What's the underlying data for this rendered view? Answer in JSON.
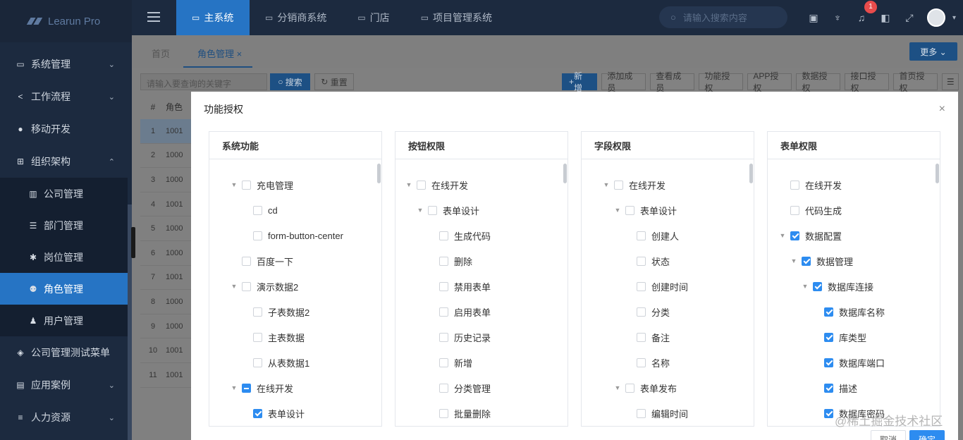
{
  "app": {
    "logo_text": "Learun Pro"
  },
  "sidebar": {
    "items": [
      {
        "label": "系统管理",
        "icon": "monitor-icon",
        "glyph": "▭",
        "chevron": "⌄"
      },
      {
        "label": "工作流程",
        "icon": "share-icon",
        "glyph": "<",
        "chevron": "⌄"
      },
      {
        "label": "移动开发",
        "icon": "github-icon",
        "glyph": "●",
        "chevron": ""
      },
      {
        "label": "组织架构",
        "icon": "sitemap-icon",
        "glyph": "⊞",
        "chevron": "⌃"
      },
      {
        "label": "公司管理",
        "icon": "bank-icon",
        "glyph": "▥",
        "sub": true
      },
      {
        "label": "部门管理",
        "icon": "list-icon",
        "glyph": "☰",
        "sub": true
      },
      {
        "label": "岗位管理",
        "icon": "gear-icon",
        "glyph": "✱",
        "sub": true
      },
      {
        "label": "角色管理",
        "icon": "users-icon",
        "glyph": "⚉",
        "sub": true,
        "active": true
      },
      {
        "label": "用户管理",
        "icon": "user-icon",
        "glyph": "♟",
        "sub": true
      },
      {
        "label": "公司管理测试菜单",
        "icon": "cube-icon",
        "glyph": "◈",
        "chevron": ""
      },
      {
        "label": "应用案例",
        "icon": "file-icon",
        "glyph": "▤",
        "chevron": "⌄"
      },
      {
        "label": "人力资源",
        "icon": "list-icon",
        "glyph": "≡",
        "chevron": "⌄"
      }
    ]
  },
  "topbar": {
    "nav": [
      {
        "label": "主系统",
        "active": true
      },
      {
        "label": "分销商系统"
      },
      {
        "label": "门店"
      },
      {
        "label": "项目管理系统"
      }
    ],
    "search_placeholder": "请输入搜索内容",
    "notification_count": "1"
  },
  "tabs": [
    {
      "label": "首页"
    },
    {
      "label": "角色管理",
      "close": "×",
      "active": true
    }
  ],
  "more_button": "更多 ⌄",
  "toolbar": {
    "keyword_placeholder": "请输入要查询的关键字",
    "search": "搜索",
    "reset": "重置",
    "actions": [
      "新增",
      "添加成员",
      "查看成员",
      "功能授权",
      "APP授权",
      "数据授权",
      "接口授权",
      "首页授权"
    ]
  },
  "table": {
    "headers": [
      "#",
      "角色"
    ],
    "rows": [
      [
        "1",
        "1001"
      ],
      [
        "2",
        "1000"
      ],
      [
        "3",
        "1000"
      ],
      [
        "4",
        "1001"
      ],
      [
        "5",
        "1000"
      ],
      [
        "6",
        "1000"
      ],
      [
        "7",
        "1001"
      ],
      [
        "8",
        "1000"
      ],
      [
        "9",
        "1000"
      ],
      [
        "10",
        "1001"
      ],
      [
        "11",
        "1001"
      ]
    ]
  },
  "modal": {
    "title": "功能授权",
    "close": "×",
    "cancel": "取消",
    "ok": "确定",
    "panels": [
      {
        "title": "系统功能",
        "nodes": [
          {
            "label": "充电管理",
            "level": 0,
            "toggle": "▼",
            "state": "none"
          },
          {
            "label": "cd",
            "level": 1,
            "toggle": "",
            "state": "none"
          },
          {
            "label": "form-button-center",
            "level": 1,
            "toggle": "",
            "state": "none"
          },
          {
            "label": "百度一下",
            "level": 0,
            "toggle": "",
            "state": "none"
          },
          {
            "label": "演示数据2",
            "level": 0,
            "toggle": "▼",
            "state": "none"
          },
          {
            "label": "子表数据2",
            "level": 1,
            "toggle": "",
            "state": "none"
          },
          {
            "label": "主表数据",
            "level": 1,
            "toggle": "",
            "state": "none"
          },
          {
            "label": "从表数据1",
            "level": 1,
            "toggle": "",
            "state": "none"
          },
          {
            "label": "在线开发",
            "level": 0,
            "toggle": "▼",
            "state": "indet"
          },
          {
            "label": "表单设计",
            "level": 1,
            "toggle": "",
            "state": "checked"
          }
        ]
      },
      {
        "title": "按钮权限",
        "nodes": [
          {
            "label": "在线开发",
            "level": 0,
            "toggle": "▼",
            "state": "none"
          },
          {
            "label": "表单设计",
            "level": 1,
            "toggle": "▼",
            "state": "none"
          },
          {
            "label": "生成代码",
            "level": 2,
            "toggle": "",
            "state": "none"
          },
          {
            "label": "删除",
            "level": 2,
            "toggle": "",
            "state": "none"
          },
          {
            "label": "禁用表单",
            "level": 2,
            "toggle": "",
            "state": "none"
          },
          {
            "label": "启用表单",
            "level": 2,
            "toggle": "",
            "state": "none"
          },
          {
            "label": "历史记录",
            "level": 2,
            "toggle": "",
            "state": "none"
          },
          {
            "label": "新增",
            "level": 2,
            "toggle": "",
            "state": "none"
          },
          {
            "label": "分类管理",
            "level": 2,
            "toggle": "",
            "state": "none"
          },
          {
            "label": "批量删除",
            "level": 2,
            "toggle": "",
            "state": "none"
          }
        ]
      },
      {
        "title": "字段权限",
        "nodes": [
          {
            "label": "在线开发",
            "level": 0,
            "toggle": "▼",
            "state": "none"
          },
          {
            "label": "表单设计",
            "level": 1,
            "toggle": "▼",
            "state": "none"
          },
          {
            "label": "创建人",
            "level": 2,
            "toggle": "",
            "state": "none"
          },
          {
            "label": "状态",
            "level": 2,
            "toggle": "",
            "state": "none"
          },
          {
            "label": "创建时间",
            "level": 2,
            "toggle": "",
            "state": "none"
          },
          {
            "label": "分类",
            "level": 2,
            "toggle": "",
            "state": "none"
          },
          {
            "label": "备注",
            "level": 2,
            "toggle": "",
            "state": "none"
          },
          {
            "label": "名称",
            "level": 2,
            "toggle": "",
            "state": "none"
          },
          {
            "label": "表单发布",
            "level": 1,
            "toggle": "▼",
            "state": "none"
          },
          {
            "label": "编辑时间",
            "level": 2,
            "toggle": "",
            "state": "none"
          }
        ]
      },
      {
        "title": "表单权限",
        "nodes": [
          {
            "label": "在线开发",
            "level": 0,
            "toggle": "",
            "state": "none"
          },
          {
            "label": "代码生成",
            "level": 0,
            "toggle": "",
            "state": "none"
          },
          {
            "label": "数据配置",
            "level": 0,
            "toggle": "▼",
            "state": "checked"
          },
          {
            "label": "数据管理",
            "level": 1,
            "toggle": "▼",
            "state": "checked"
          },
          {
            "label": "数据库连接",
            "level": 2,
            "toggle": "▼",
            "state": "checked"
          },
          {
            "label": "数据库名称",
            "level": 3,
            "toggle": "",
            "state": "checked"
          },
          {
            "label": "库类型",
            "level": 3,
            "toggle": "",
            "state": "checked"
          },
          {
            "label": "数据库端口",
            "level": 3,
            "toggle": "",
            "state": "checked"
          },
          {
            "label": "描述",
            "level": 3,
            "toggle": "",
            "state": "checked"
          },
          {
            "label": "数据库密码",
            "level": 3,
            "toggle": "",
            "state": "checked"
          }
        ]
      }
    ]
  },
  "watermark": "@稀土掘金技术社区",
  "colors": {
    "primary": "#2d8cf0",
    "sidebar": "#1c2a3f",
    "active": "#2674c4"
  }
}
